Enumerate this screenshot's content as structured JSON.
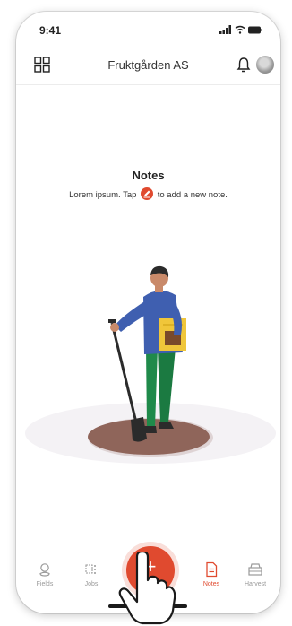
{
  "status_bar": {
    "time": "9:41"
  },
  "header": {
    "title": "Fruktgården AS"
  },
  "empty_state": {
    "title": "Notes",
    "desc_before": "Lorem ipsum. Tap",
    "desc_after": "to add a new note."
  },
  "tabs": [
    {
      "label": "Fields",
      "icon": "map-pin-icon",
      "active": false
    },
    {
      "label": "Jobs",
      "icon": "tasks-icon",
      "active": false
    },
    {
      "label": "Notes",
      "icon": "document-icon",
      "active": true
    },
    {
      "label": "Harvest",
      "icon": "crate-icon",
      "active": false
    }
  ],
  "fab": {
    "symbol": "+"
  },
  "colors": {
    "accent": "#e04a2f",
    "shirt": "#3f5fb0",
    "pants": "#1f8a4a",
    "ground": "#8f655a"
  }
}
